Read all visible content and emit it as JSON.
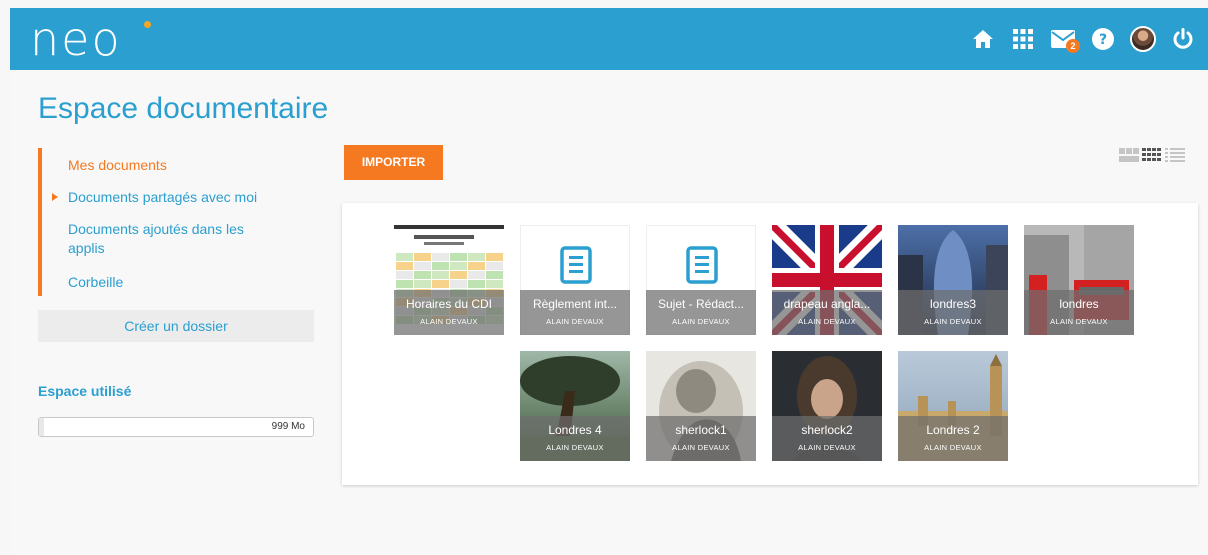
{
  "header": {
    "logo": "neo",
    "mail_badge": "2",
    "icons": [
      "home-icon",
      "apps-icon",
      "mail-icon",
      "help-icon",
      "avatar",
      "power-icon"
    ]
  },
  "page": {
    "title": "Espace documentaire"
  },
  "sidebar": {
    "items": [
      {
        "label": "Mes documents",
        "active": true
      },
      {
        "label": "Documents partagés avec moi",
        "active": false
      },
      {
        "label": "Documents ajoutés dans les applis",
        "active": false
      },
      {
        "label": "Corbeille",
        "active": false
      }
    ],
    "create_folder": "Créer un dossier"
  },
  "storage": {
    "title": "Espace utilisé",
    "value": "999 Mo",
    "used_fraction": 0.02
  },
  "toolbar": {
    "import_label": "IMPORTER"
  },
  "documents": [
    {
      "name": "Horaires du CDI",
      "owner": "ALAIN DEVAUX",
      "type": "spreadsheet"
    },
    {
      "name": "Règlement int...",
      "owner": "ALAIN DEVAUX",
      "type": "doc"
    },
    {
      "name": "Sujet - Rédact...",
      "owner": "ALAIN DEVAUX",
      "type": "doc"
    },
    {
      "name": "drapeau angla...",
      "owner": "ALAIN DEVAUX",
      "type": "flag"
    },
    {
      "name": "londres3",
      "owner": "ALAIN DEVAUX",
      "type": "tower"
    },
    {
      "name": "londres",
      "owner": "ALAIN DEVAUX",
      "type": "street"
    },
    {
      "name": "Londres 4",
      "owner": "ALAIN DEVAUX",
      "type": "tree"
    },
    {
      "name": "sherlock1",
      "owner": "ALAIN DEVAUX",
      "type": "sketch"
    },
    {
      "name": "sherlock2",
      "owner": "ALAIN DEVAUX",
      "type": "portrait"
    },
    {
      "name": "Londres 2",
      "owner": "ALAIN DEVAUX",
      "type": "parliament"
    }
  ],
  "colors": {
    "brand": "#2a9fd0",
    "accent": "#f47920"
  }
}
